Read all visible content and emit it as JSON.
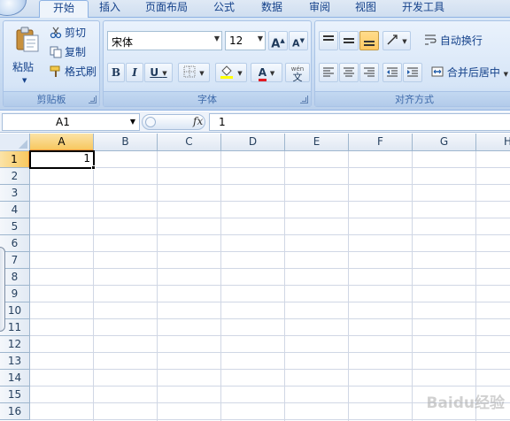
{
  "tabs": [
    "开始",
    "插入",
    "页面布局",
    "公式",
    "数据",
    "审阅",
    "视图",
    "开发工具"
  ],
  "active_tab": "开始",
  "clipboard": {
    "paste_label": "粘贴",
    "cut_label": "剪切",
    "copy_label": "复制",
    "format_painter_label": "格式刷",
    "group_label": "剪贴板"
  },
  "font": {
    "font_name": "宋体",
    "font_size": "12",
    "bold": "B",
    "italic": "I",
    "underline": "U",
    "font_color_glyph": "A",
    "grow_glyph": "A",
    "shrink_glyph": "A",
    "phonetic_top": "wén",
    "phonetic_glyph": "文",
    "group_label": "字体",
    "font_color_hex": "#e21b23",
    "fill_color_hex": "#ffff00"
  },
  "alignment": {
    "wrap_text_label": "自动换行",
    "merge_center_label": "合并后居中",
    "group_label": "对齐方式"
  },
  "formula_bar": {
    "name_box": "A1",
    "fx_label": "fx",
    "formula_value": "1"
  },
  "grid": {
    "columns": [
      "A",
      "B",
      "C",
      "D",
      "E",
      "F",
      "G",
      "H"
    ],
    "rows": [
      "1",
      "2",
      "3",
      "4",
      "5",
      "6",
      "7",
      "8",
      "9",
      "10",
      "11",
      "12",
      "13",
      "14",
      "15",
      "16"
    ],
    "selected_column": "A",
    "selected_row": "1",
    "active_cell_value": "1"
  },
  "watermark": "Baidu经验"
}
